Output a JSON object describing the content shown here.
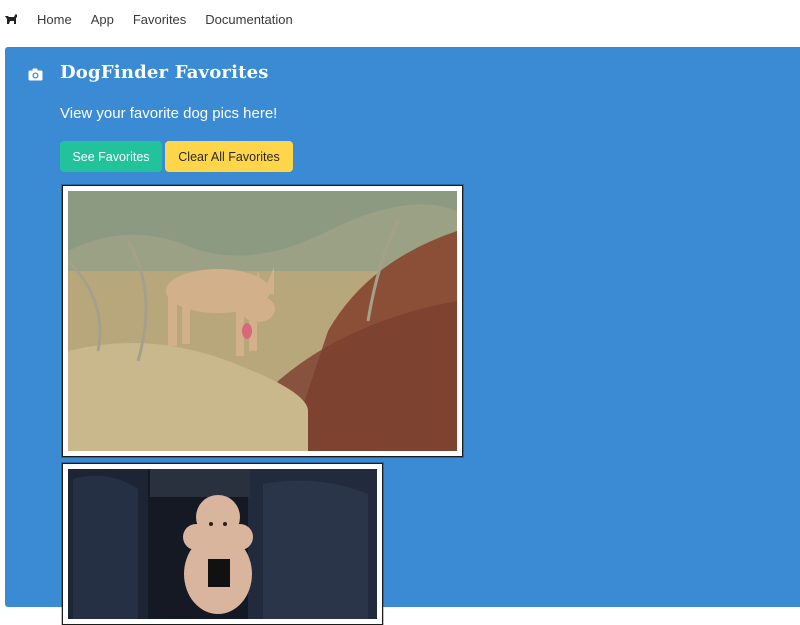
{
  "nav": {
    "brand_icon": "dog-icon",
    "links": [
      "Home",
      "App",
      "Favorites",
      "Documentation"
    ]
  },
  "main": {
    "icon": "camera-icon",
    "title": "DogFinder Favorites",
    "subtitle": "View your favorite dog pics here!",
    "buttons": {
      "see_favorites": "See Favorites",
      "clear_all": "Clear All Favorites"
    },
    "photos": [
      {
        "subject": "dingo-in-grass-photo"
      },
      {
        "subject": "poodle-in-car-seat-photo"
      }
    ]
  },
  "colors": {
    "panel": "#3a8bd3",
    "primary_button": "#22c29c",
    "warning_button": "#ffd54a"
  }
}
